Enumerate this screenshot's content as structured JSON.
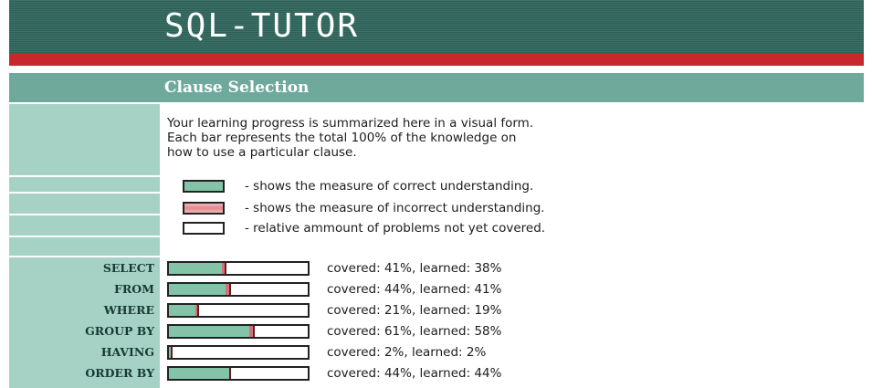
{
  "app": {
    "title": "SQL-TUTOR"
  },
  "section": {
    "title": "Clause Selection"
  },
  "intro": {
    "lines": [
      "Your learning progress is summarized here in a visual form.",
      "Each bar represents the total 100% of the knowledge on",
      "how to use a particular clause."
    ]
  },
  "legend": {
    "items": [
      {
        "text": "- shows the measure of correct understanding.",
        "color": "#83c4a8"
      },
      {
        "text": "- shows the measure of incorrect understanding.",
        "color": "#e08a8e"
      },
      {
        "text": "- relative ammount of problems not yet covered.",
        "color": "#ffffff"
      }
    ]
  },
  "clauses": [
    {
      "name": "SELECT",
      "covered": 41,
      "learned": 38,
      "text": "covered: 41%, learned: 38%"
    },
    {
      "name": "FROM",
      "covered": 44,
      "learned": 41,
      "text": "covered: 44%, learned: 41%"
    },
    {
      "name": "WHERE",
      "covered": 21,
      "learned": 19,
      "text": "covered: 21%, learned: 19%"
    },
    {
      "name": "GROUP BY",
      "covered": 61,
      "learned": 58,
      "text": "covered: 61%, learned: 58%"
    },
    {
      "name": "HAVING",
      "covered": 2,
      "learned": 2,
      "text": "covered: 2%, learned: 2%"
    },
    {
      "name": "ORDER BY",
      "covered": 44,
      "learned": 44,
      "text": "covered: 44%, learned: 44%"
    }
  ],
  "colors": {
    "header": "#2f5f56",
    "accent_red": "#c8282c",
    "section": "#6fa99c",
    "sidebar": "#a6d2c5",
    "correct": "#83c4a8",
    "incorrect": "#d27278"
  }
}
